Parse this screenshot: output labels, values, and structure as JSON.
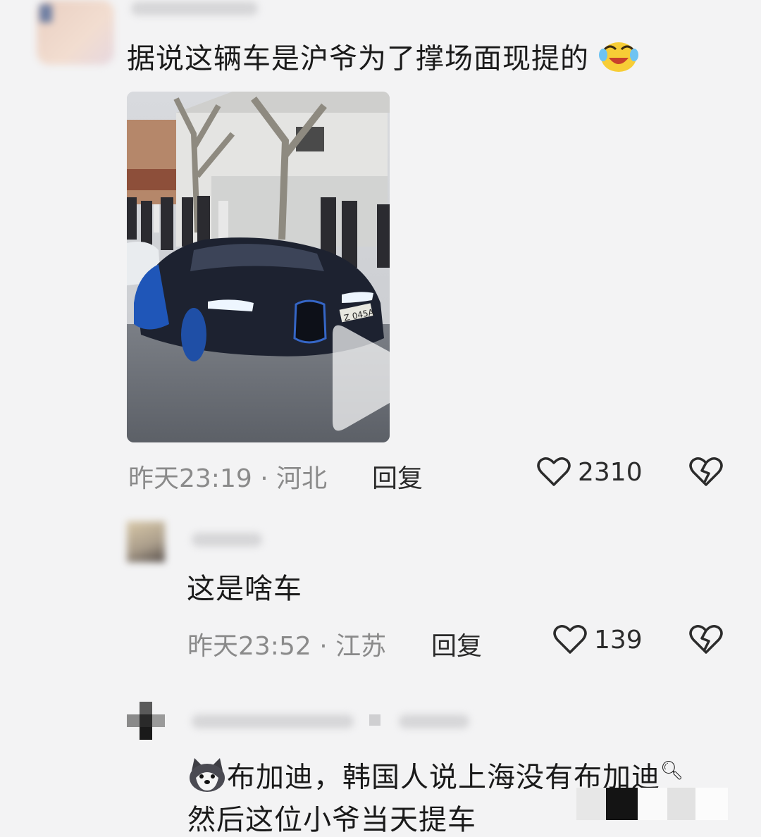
{
  "post": {
    "text": "据说这辆车是沪爷为了撑场面现提的",
    "emoji_icon": "laugh-cry-icon",
    "video_plate": "Z 045A",
    "meta_time": "昨天23:19",
    "meta_sep": "·",
    "meta_location": "河北",
    "reply_label": "回复",
    "likes": "2310"
  },
  "reply1": {
    "text": "这是啥车",
    "meta_time": "昨天23:52",
    "meta_sep": "·",
    "meta_location": "江苏",
    "reply_label": "回复",
    "likes": "139"
  },
  "reply2": {
    "avatar_emoji": "husky-dog-icon",
    "text": "布加迪，韩国人说上海没有布加迪",
    "search_icon": "search-icon",
    "line2": "然后这位小爷当天提车"
  },
  "colors": {
    "background": "#f3f3f4",
    "meta_gray": "#8a8a8a",
    "text": "#1a1a1a"
  }
}
